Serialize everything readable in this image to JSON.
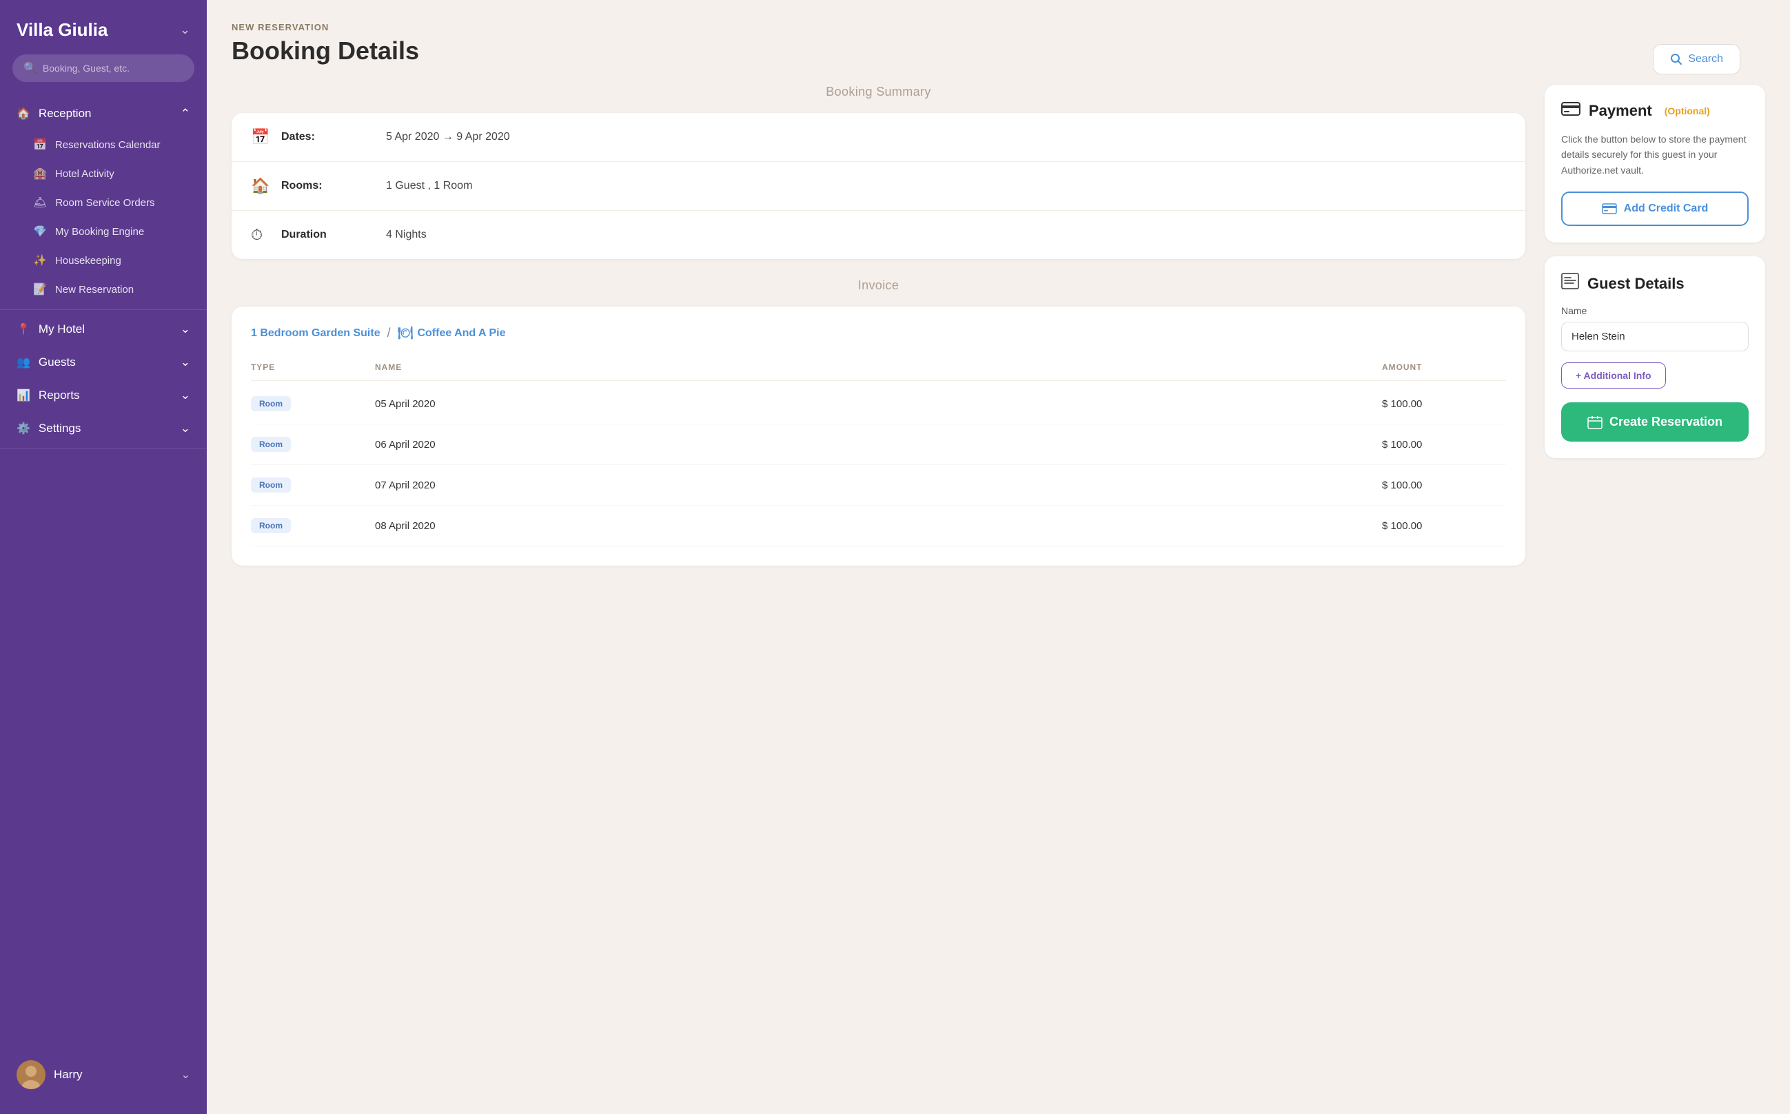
{
  "sidebar": {
    "hotel_name": "Villa Giulia",
    "search_placeholder": "Booking, Guest, etc.",
    "nav_groups": [
      {
        "id": "reception",
        "label": "Reception",
        "icon": "🏠",
        "expanded": true,
        "items": [
          {
            "id": "reservations-calendar",
            "label": "Reservations Calendar",
            "icon": "📅"
          },
          {
            "id": "hotel-activity",
            "label": "Hotel Activity",
            "icon": "🏨"
          },
          {
            "id": "room-service-orders",
            "label": "Room Service Orders",
            "icon": "🛎"
          },
          {
            "id": "my-booking-engine",
            "label": "My Booking Engine",
            "icon": "💎"
          },
          {
            "id": "housekeeping",
            "label": "Housekeeping",
            "icon": "✨"
          },
          {
            "id": "new-reservation",
            "label": "New Reservation",
            "icon": "📝"
          }
        ]
      },
      {
        "id": "my-hotel",
        "label": "My Hotel",
        "icon": "📍",
        "expanded": false,
        "items": []
      },
      {
        "id": "guests",
        "label": "Guests",
        "icon": "👥",
        "expanded": false,
        "items": []
      },
      {
        "id": "reports",
        "label": "Reports",
        "icon": "📊",
        "expanded": false,
        "items": []
      },
      {
        "id": "settings",
        "label": "Settings",
        "icon": "⚙️",
        "expanded": false,
        "items": []
      }
    ],
    "user": {
      "name": "Harry",
      "avatar_emoji": "👤"
    }
  },
  "header": {
    "page_label": "NEW RESERVATION",
    "page_title": "Booking Details",
    "search_button": "Search"
  },
  "booking_summary": {
    "section_title": "Booking Summary",
    "rows": [
      {
        "id": "dates",
        "icon": "📅",
        "label": "Dates:",
        "value": "5 Apr 2020 → 9 Apr 2020"
      },
      {
        "id": "rooms",
        "icon": "🏠",
        "label": "Rooms:",
        "value": "1 Guest , 1 Room"
      },
      {
        "id": "duration",
        "icon": "⏱",
        "label": "Duration",
        "value": "4 Nights"
      }
    ]
  },
  "invoice": {
    "section_title": "Invoice",
    "room_link": "1 Bedroom Garden Suite",
    "service_link": "Coffee And A Pie",
    "table": {
      "columns": [
        "TYPE",
        "NAME",
        "AMOUNT"
      ],
      "rows": [
        {
          "type": "Room",
          "name": "05 April 2020",
          "amount": "$ 100.00"
        },
        {
          "type": "Room",
          "name": "06 April 2020",
          "amount": "$ 100.00"
        },
        {
          "type": "Room",
          "name": "07 April 2020",
          "amount": "$ 100.00"
        },
        {
          "type": "Room",
          "name": "08 April 2020",
          "amount": "$ 100.00"
        }
      ]
    }
  },
  "payment_panel": {
    "icon": "💳",
    "title": "Payment",
    "subtitle": "(Optional)",
    "description": "Click the button below to store the payment details securely for this guest in your Authorize.net vault.",
    "add_credit_card_label": "Add Credit Card"
  },
  "guest_details_panel": {
    "icon": "📋",
    "title": "Guest Details",
    "name_label": "Name",
    "name_value": "Helen Stein",
    "additional_info_label": "+ Additional Info",
    "create_reservation_label": "Create Reservation"
  }
}
